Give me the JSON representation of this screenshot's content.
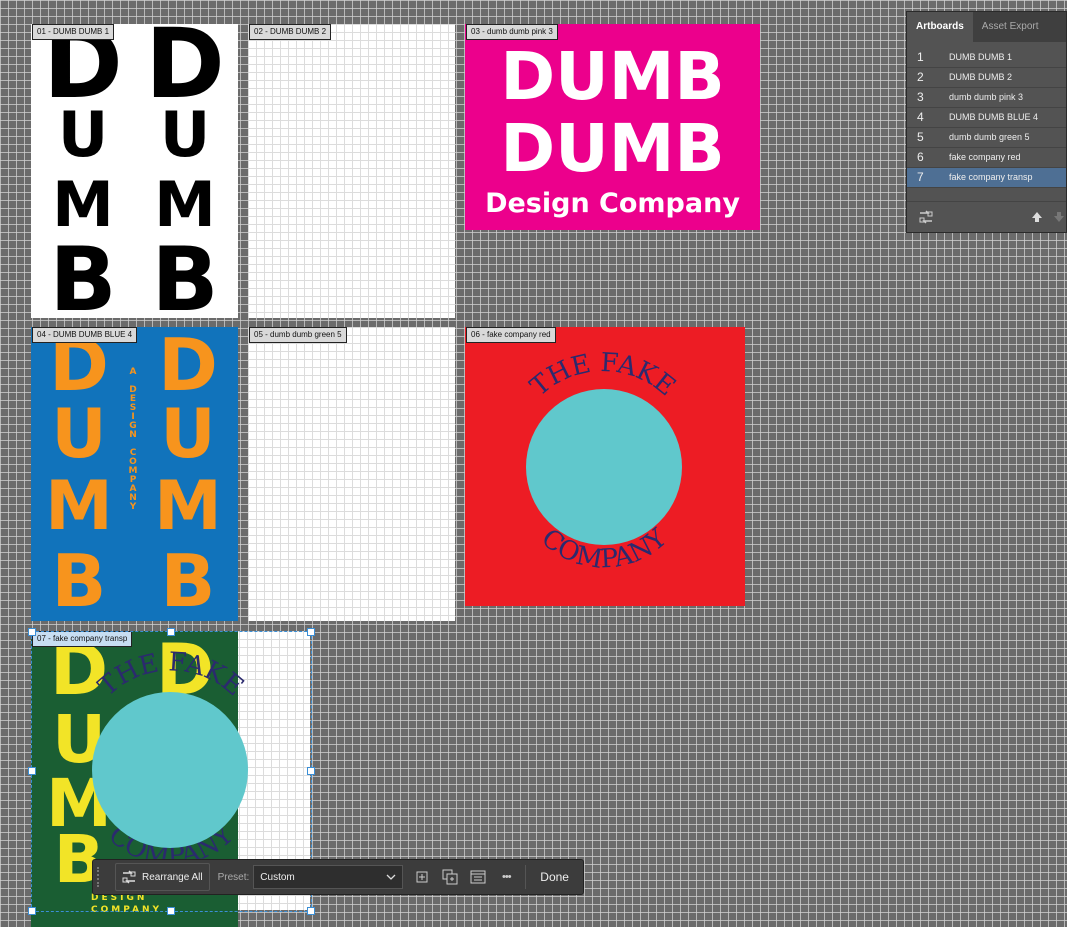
{
  "artboards": [
    {
      "label": "01 - DUMB DUMB 1"
    },
    {
      "label": "02 - DUMB DUMB 2"
    },
    {
      "label": "03 - dumb dumb pink 3"
    },
    {
      "label": "04 - DUMB DUMB BLUE 4"
    },
    {
      "label": "05 - dumb dumb green 5"
    },
    {
      "label": "06 - fake company red"
    },
    {
      "label": "07 - fake company transp"
    }
  ],
  "art": {
    "d": "D",
    "u": "U",
    "m": "M",
    "b": "B",
    "dumb": "DUMB",
    "design_company": "Design Company",
    "a_design_company": "A DESIGN COMPANY",
    "design": "DESIGN",
    "company_caps": "COMPANY",
    "the_fake": "THE FAKE",
    "company": "COMPANY"
  },
  "panel": {
    "tabs": [
      "Artboards",
      "Asset Export"
    ],
    "rows": [
      {
        "num": "1",
        "name": "DUMB DUMB 1"
      },
      {
        "num": "2",
        "name": "DUMB DUMB 2"
      },
      {
        "num": "3",
        "name": "dumb dumb pink 3"
      },
      {
        "num": "4",
        "name": "DUMB DUMB BLUE 4"
      },
      {
        "num": "5",
        "name": "dumb dumb green 5"
      },
      {
        "num": "6",
        "name": "fake company red"
      },
      {
        "num": "7",
        "name": "fake company transp"
      }
    ],
    "selected_index": 6
  },
  "toolbar": {
    "rearrange_label": "Rearrange All",
    "preset_label": "Preset:",
    "preset_value": "Custom",
    "more_label": "•••",
    "done_label": "Done"
  },
  "icons": [
    "rearrange-icon",
    "chevron-down-icon",
    "add-artboard-icon",
    "duplicate-artboard-icon",
    "properties-icon",
    "more-icon",
    "arrow-up-icon",
    "arrow-down-icon"
  ],
  "colors": {
    "pink": "#ec008c",
    "blue": "#1173bb",
    "orange": "#f7941d",
    "red": "#ed1c24",
    "teal": "#60c8cc",
    "navy": "#2b2a6e",
    "green": "#1a5e33",
    "yellow": "#f2e427",
    "selection": "#3b8fd6"
  }
}
